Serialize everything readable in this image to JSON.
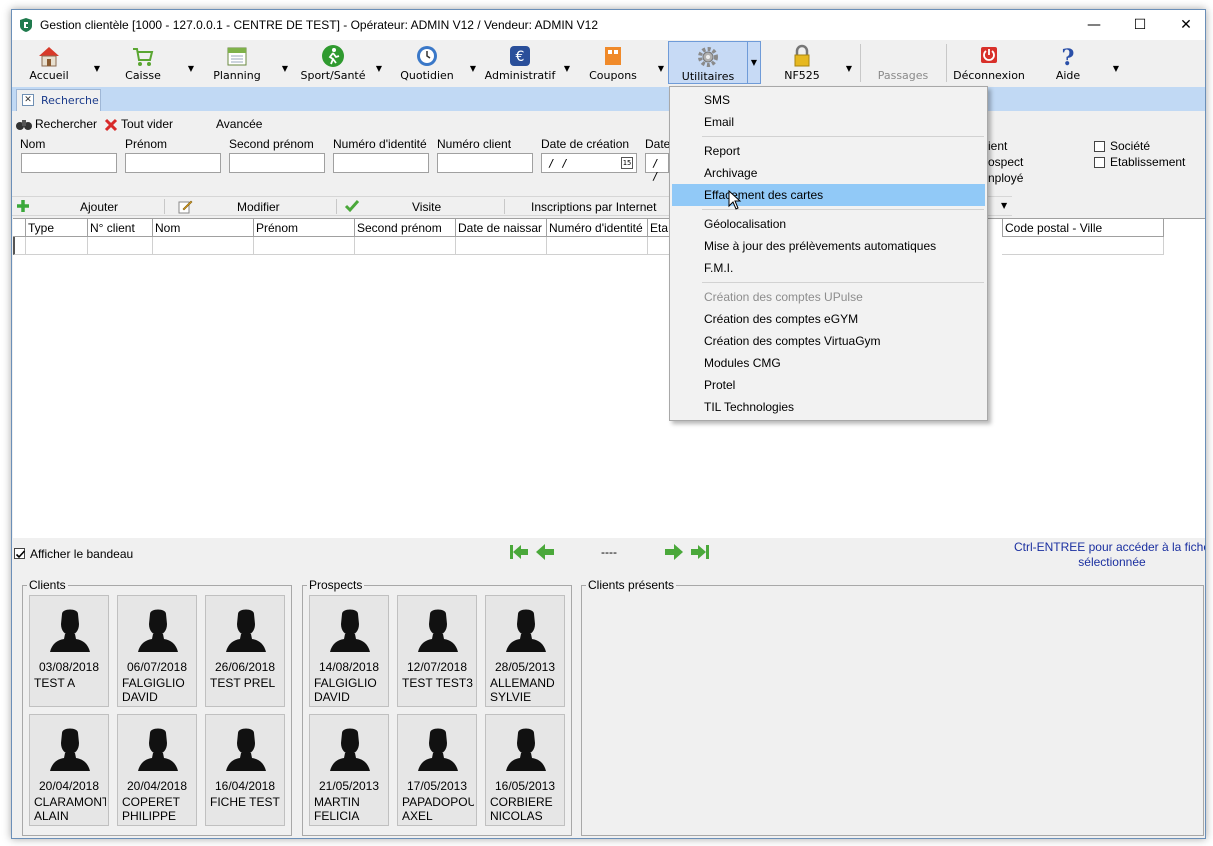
{
  "window": {
    "title": "Gestion clientèle [1000 - 127.0.0.1 - CENTRE DE TEST] - Opérateur: ADMIN V12 / Vendeur: ADMIN V12",
    "minimize": "—",
    "maximize": "☐",
    "close": "✕"
  },
  "toolbar": {
    "accueil": "Accueil",
    "caisse": "Caisse",
    "planning": "Planning",
    "sport": "Sport/Santé",
    "quotidien": "Quotidien",
    "administratif": "Administratif",
    "coupons": "Coupons",
    "utilitaires": "Utilitaires",
    "nf525": "NF525",
    "passages": "Passages",
    "deconnexion": "Déconnexion",
    "aide": "Aide",
    "dropdown_glyph": "▼"
  },
  "tabs": {
    "recherche": "Recherche",
    "close_glyph": "✕"
  },
  "search_actions": {
    "rechercher": "Rechercher",
    "tout_vider": "Tout vider",
    "avancee": "Avancée"
  },
  "fields": {
    "nom": "Nom",
    "prenom": "Prénom",
    "second_prenom": "Second prénom",
    "numero_identite": "Numéro d'identité",
    "numero_client": "Numéro client",
    "date_creation": "Date de création",
    "date_partial": "Date",
    "date_value": "/ /",
    "date_partial_value": "/ /",
    "cal_glyph": "15"
  },
  "filters": {
    "client_partial": "ient",
    "prospect_partial": "ospect",
    "employe_partial": "nployé",
    "societe": "Société",
    "etablissement": "Etablissement"
  },
  "list_actions": {
    "ajouter": "Ajouter",
    "modifier": "Modifier",
    "visite": "Visite",
    "inscriptions": "Inscriptions par Internet"
  },
  "grid": {
    "columns": [
      "Type",
      "N° client",
      "Nom",
      "Prénom",
      "Second prénom",
      "Date de naissar",
      "Numéro d'identité",
      "Eta"
    ],
    "col_code_postal": "Code postal - Ville"
  },
  "menu": {
    "sms": "SMS",
    "email": "Email",
    "report": "Report",
    "archivage": "Archivage",
    "effacement": "Effacement des cartes",
    "geolocalisation": "Géolocalisation",
    "maj_prelevements": "Mise à jour des prélèvements automatiques",
    "fmi": "F.M.I.",
    "upulse": "Création des comptes UPulse",
    "egym": "Création des comptes eGYM",
    "virtuagym": "Création des comptes VirtuaGym",
    "cmg": "Modules CMG",
    "protel": "Protel",
    "til": "TIL Technologies"
  },
  "bottom": {
    "afficher_bandeau": "Afficher le bandeau",
    "page_indicator": "----",
    "hint": "Ctrl-ENTREE pour accéder à la fiche sélectionnée"
  },
  "groups": {
    "clients_title": "Clients",
    "prospects_title": "Prospects",
    "presents_title": "Clients présents",
    "clients": [
      {
        "date": "03/08/2018",
        "name": "TEST A"
      },
      {
        "date": "06/07/2018",
        "name": "FALGIGLIO\nDAVID"
      },
      {
        "date": "26/06/2018",
        "name": "TEST PREL"
      },
      {
        "date": "20/04/2018",
        "name": "CLARAMONT\nALAIN"
      },
      {
        "date": "20/04/2018",
        "name": "COPERET\nPHILIPPE"
      },
      {
        "date": "16/04/2018",
        "name": "FICHE TEST"
      }
    ],
    "prospects": [
      {
        "date": "14/08/2018",
        "name": "FALGIGLIO\nDAVID"
      },
      {
        "date": "12/07/2018",
        "name": "TEST TEST3"
      },
      {
        "date": "28/05/2013",
        "name": "ALLEMAND\nSYLVIE"
      },
      {
        "date": "21/05/2013",
        "name": "MARTIN\nFELICIA"
      },
      {
        "date": "17/05/2013",
        "name": "PAPADOPOULOS\nAXEL"
      },
      {
        "date": "16/05/2013",
        "name": "CORBIERE\nNICOLAS"
      }
    ]
  },
  "colors": {
    "accent": "#c7daf5",
    "menu_highlight": "#91c9f7",
    "tab_strip": "#c1d9f4",
    "hint_text": "#1a2fa0"
  }
}
